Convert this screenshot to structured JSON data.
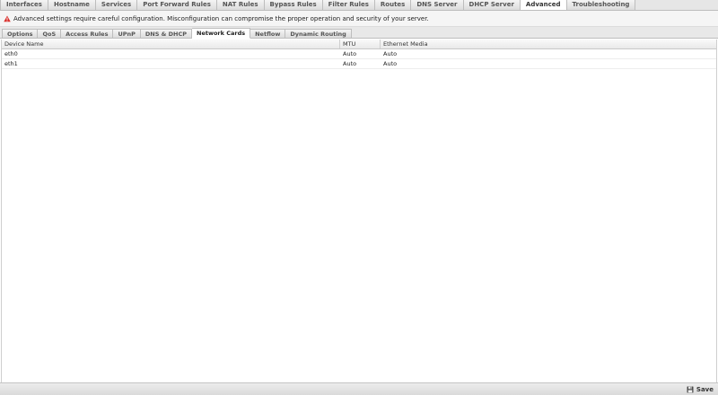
{
  "top_tabs": [
    "Interfaces",
    "Hostname",
    "Services",
    "Port Forward Rules",
    "NAT Rules",
    "Bypass Rules",
    "Filter Rules",
    "Routes",
    "DNS Server",
    "DHCP Server",
    "Advanced",
    "Troubleshooting"
  ],
  "top_tabs_active": "Advanced",
  "warning": {
    "icon": "warning-triangle-icon",
    "text": "Advanced settings require careful configuration. Misconfiguration can compromise the proper operation and security of your server."
  },
  "sub_tabs": [
    "Options",
    "QoS",
    "Access Rules",
    "UPnP",
    "DNS & DHCP",
    "Network Cards",
    "Netflow",
    "Dynamic Routing"
  ],
  "sub_tabs_active": "Network Cards",
  "grid": {
    "columns": [
      "Device Name",
      "MTU",
      "Ethernet Media"
    ],
    "rows": [
      [
        "eth0",
        "Auto",
        "Auto"
      ],
      [
        "eth1",
        "Auto",
        "Auto"
      ]
    ]
  },
  "footer": {
    "save_label": "Save",
    "save_icon": "floppy-disk-icon"
  },
  "colors": {
    "warning_red": "#d9302c",
    "active_tab": "#ffffff",
    "tab_bg": "#dcdcdc"
  }
}
